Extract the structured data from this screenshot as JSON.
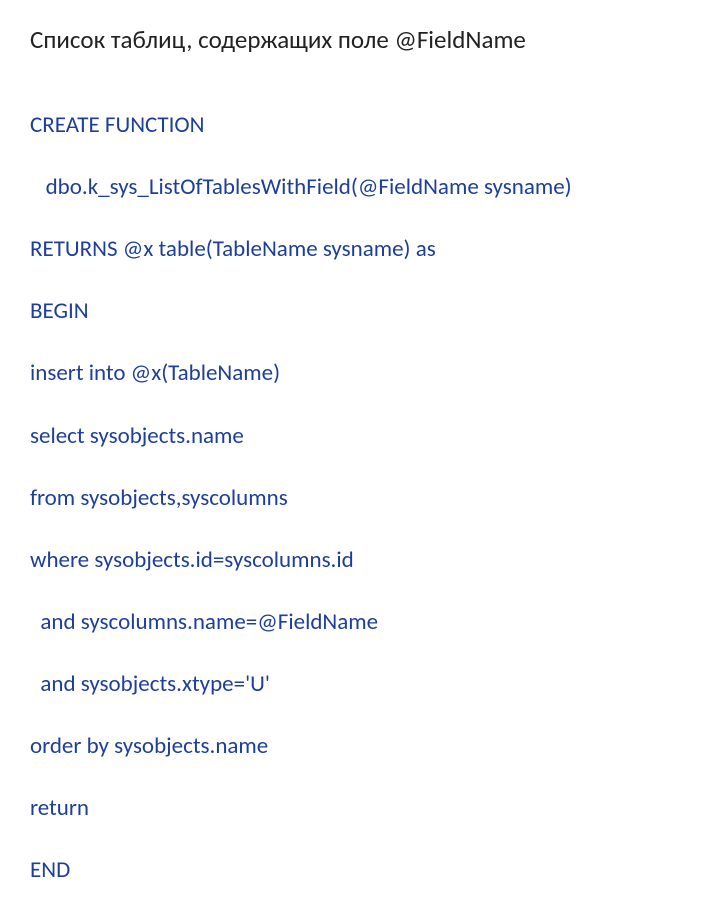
{
  "title": "Список таблиц, содержащих поле @FieldName",
  "code": {
    "line1": "CREATE FUNCTION",
    "line2": "   dbo.k_sys_ListOfTablesWithField(@FieldName sysname)",
    "line3": "RETURNS @x table(TableName sysname) as",
    "line4": "BEGIN",
    "line5": "insert into @x(TableName)",
    "line6": "select sysobjects.name",
    "line7": "from sysobjects,syscolumns",
    "line8": "where sysobjects.id=syscolumns.id",
    "line9": "  and syscolumns.name=@FieldName",
    "line10": "  and sysobjects.xtype='U'",
    "line11": "order by sysobjects.name",
    "line12": "return",
    "line13": "END"
  }
}
